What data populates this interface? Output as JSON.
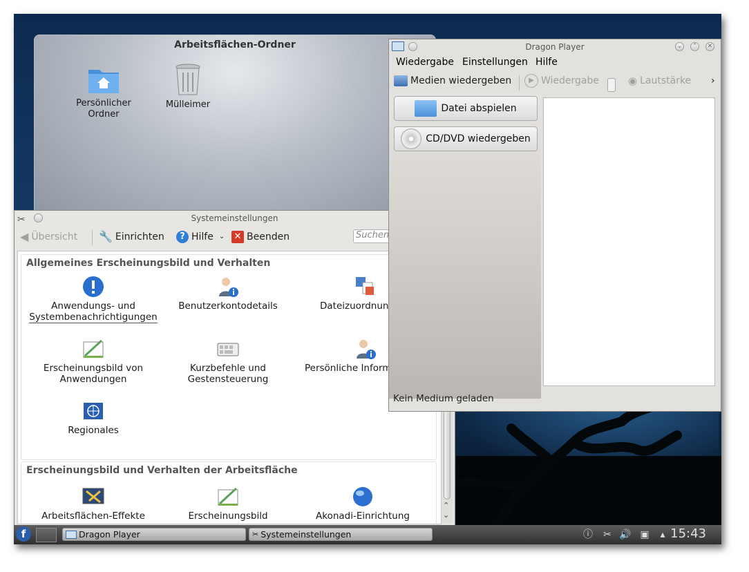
{
  "folder_view": {
    "title": "Arbeitsflächen-Ordner",
    "items": [
      {
        "label_line1": "Persönlicher",
        "label_line2": "Ordner",
        "icon": "home-folder-icon"
      },
      {
        "label_line1": "Mülleimer",
        "label_line2": "",
        "icon": "trash-icon"
      }
    ]
  },
  "settings": {
    "window_title": "Systemeinstellungen",
    "toolbar": {
      "overview": "Übersicht",
      "configure": "Einrichten",
      "help": "Hilfe",
      "quit": "Beenden",
      "search_placeholder": "Suchen"
    },
    "section1": {
      "title": "Allgemeines Erscheinungsbild und Verhalten",
      "modules": [
        {
          "line1": "Anwendungs- und",
          "line2": "Systembenachrichtigungen"
        },
        {
          "line1": "Benutzerkontodetails",
          "line2": ""
        },
        {
          "line1": "Dateizuordnun",
          "line2": ""
        },
        {
          "line1": "Erscheinungsbild von",
          "line2": "Anwendungen"
        },
        {
          "line1": "Kurzbefehle und",
          "line2": "Gestensteuerung"
        },
        {
          "line1": "Persönliche Inform",
          "line2": ""
        },
        {
          "line1": "Regionales",
          "line2": ""
        }
      ]
    },
    "section2": {
      "title": "Erscheinungsbild und Verhalten der Arbeitsfläche",
      "modules": [
        {
          "line1": "Arbeitsflächen-Effekte"
        },
        {
          "line1": "Erscheinungsbild"
        },
        {
          "line1": "Akonadi-Einrichtung"
        }
      ]
    }
  },
  "dragon": {
    "window_title": "Dragon Player",
    "menu": [
      "Wiedergabe",
      "Einstellungen",
      "Hilfe"
    ],
    "toolbar": {
      "play_media": "Medien wiedergeben",
      "playback": "Wiedergabe",
      "volume": "Lautstärke",
      "more": "›"
    },
    "buttons": {
      "play_file": "Datei abspielen",
      "play_disc": "CD/DVD wiedergeben"
    },
    "status": "Kein Medium geladen"
  },
  "taskbar": {
    "tasks": [
      "Dragon Player",
      "Systemeinstellungen"
    ],
    "clock": "15:43"
  }
}
